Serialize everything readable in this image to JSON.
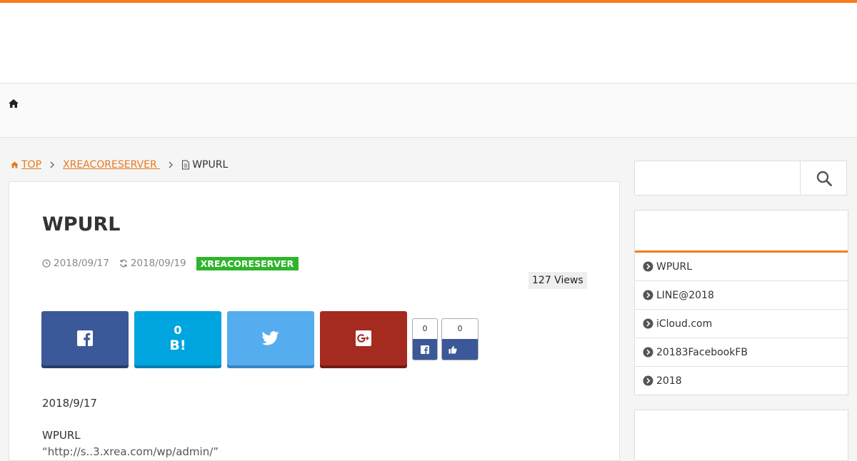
{
  "breadcrumb": {
    "home_label": "TOP",
    "category_label": "XREACORESERVER ",
    "current_label": "WPURL"
  },
  "article": {
    "title": "WPURL",
    "published": "2018/09/17",
    "updated": "2018/09/19",
    "category": "XREACORESERVER",
    "views": "127 Views",
    "share": {
      "hatena_count": "0",
      "hatena_mark": "B!",
      "fb_count": "0",
      "like_count": "0"
    },
    "body_date": "2018/9/17",
    "body_text": "WPURL",
    "body_text2": "“http://s..3.xrea.com/wp/admin/”"
  },
  "search": {
    "placeholder": ""
  },
  "sidebar": {
    "recent_items": [
      {
        "label": "WPURL"
      },
      {
        "label": "LINE@2018"
      },
      {
        "label": "iCloud.com"
      },
      {
        "label": "20183FacebookFB"
      },
      {
        "label": "2018"
      }
    ]
  },
  "colors": {
    "accent": "#f97c1b",
    "category_badge": "#2fb52b",
    "facebook": "#3b5998",
    "hatena": "#00a4de",
    "twitter": "#55acee",
    "googleplus": "#a52a1f"
  },
  "icons": {
    "home": "home-icon",
    "chevron": "chevron-right-icon",
    "page": "document-icon",
    "clock": "clock-icon",
    "refresh": "refresh-icon",
    "facebook": "facebook-icon",
    "twitter": "twitter-icon",
    "googleplus": "google-plus-icon",
    "like": "thumbs-up-icon",
    "search": "search-icon",
    "bullet": "chevron-circle-right-icon"
  }
}
